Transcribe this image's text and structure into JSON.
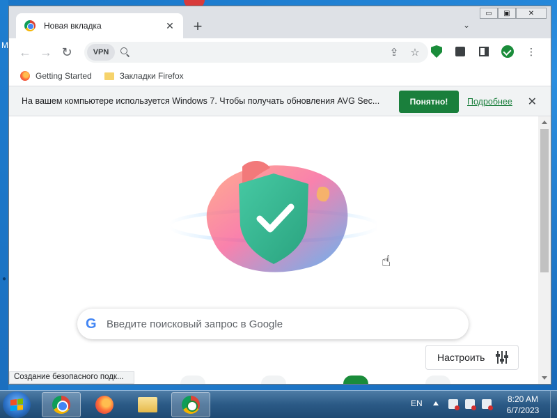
{
  "browser": {
    "tab": {
      "title": "Новая вкладка",
      "close_glyph": "✕"
    },
    "new_tab_glyph": "+",
    "tab_search_glyph": "⌄",
    "window_controls": {
      "minimize": "▭",
      "maximize": "▣",
      "close": "✕"
    },
    "toolbar": {
      "back_glyph": "←",
      "forward_glyph": "→",
      "reload_glyph": "↻",
      "vpn_label": "VPN",
      "omnibox_value": "",
      "share_glyph": "⇪",
      "bookmark_glyph": "☆",
      "menu_glyph": "⋮"
    },
    "bookmarks": [
      {
        "label": "Getting Started",
        "icon": "firefox-icon"
      },
      {
        "label": "Закладки Firefox",
        "icon": "folder-icon"
      }
    ]
  },
  "infobar": {
    "message": "На вашем компьютере используется Windows 7. Чтобы получать обновления AVG Sec...",
    "ok_label": "Понятно!",
    "more_label": "Подробнее",
    "close_glyph": "✕"
  },
  "newtab": {
    "search_placeholder": "Введите поисковый запрос в Google",
    "google_glyph": "G",
    "customize_label": "Настроить",
    "status_text": "Создание безопасного подк..."
  },
  "taskbar": {
    "apps": [
      "chrome-icon",
      "firefox-icon",
      "explorer-icon",
      "avg-browser-icon"
    ],
    "language": "EN",
    "time": "8:20 AM",
    "date": "6/7/2023"
  },
  "colors": {
    "accent_green": "#1a7f3c",
    "infobar_bg": "#f1f3f4",
    "tabstrip_bg": "#dee1e6",
    "desktop_blue": "#1976c8"
  }
}
